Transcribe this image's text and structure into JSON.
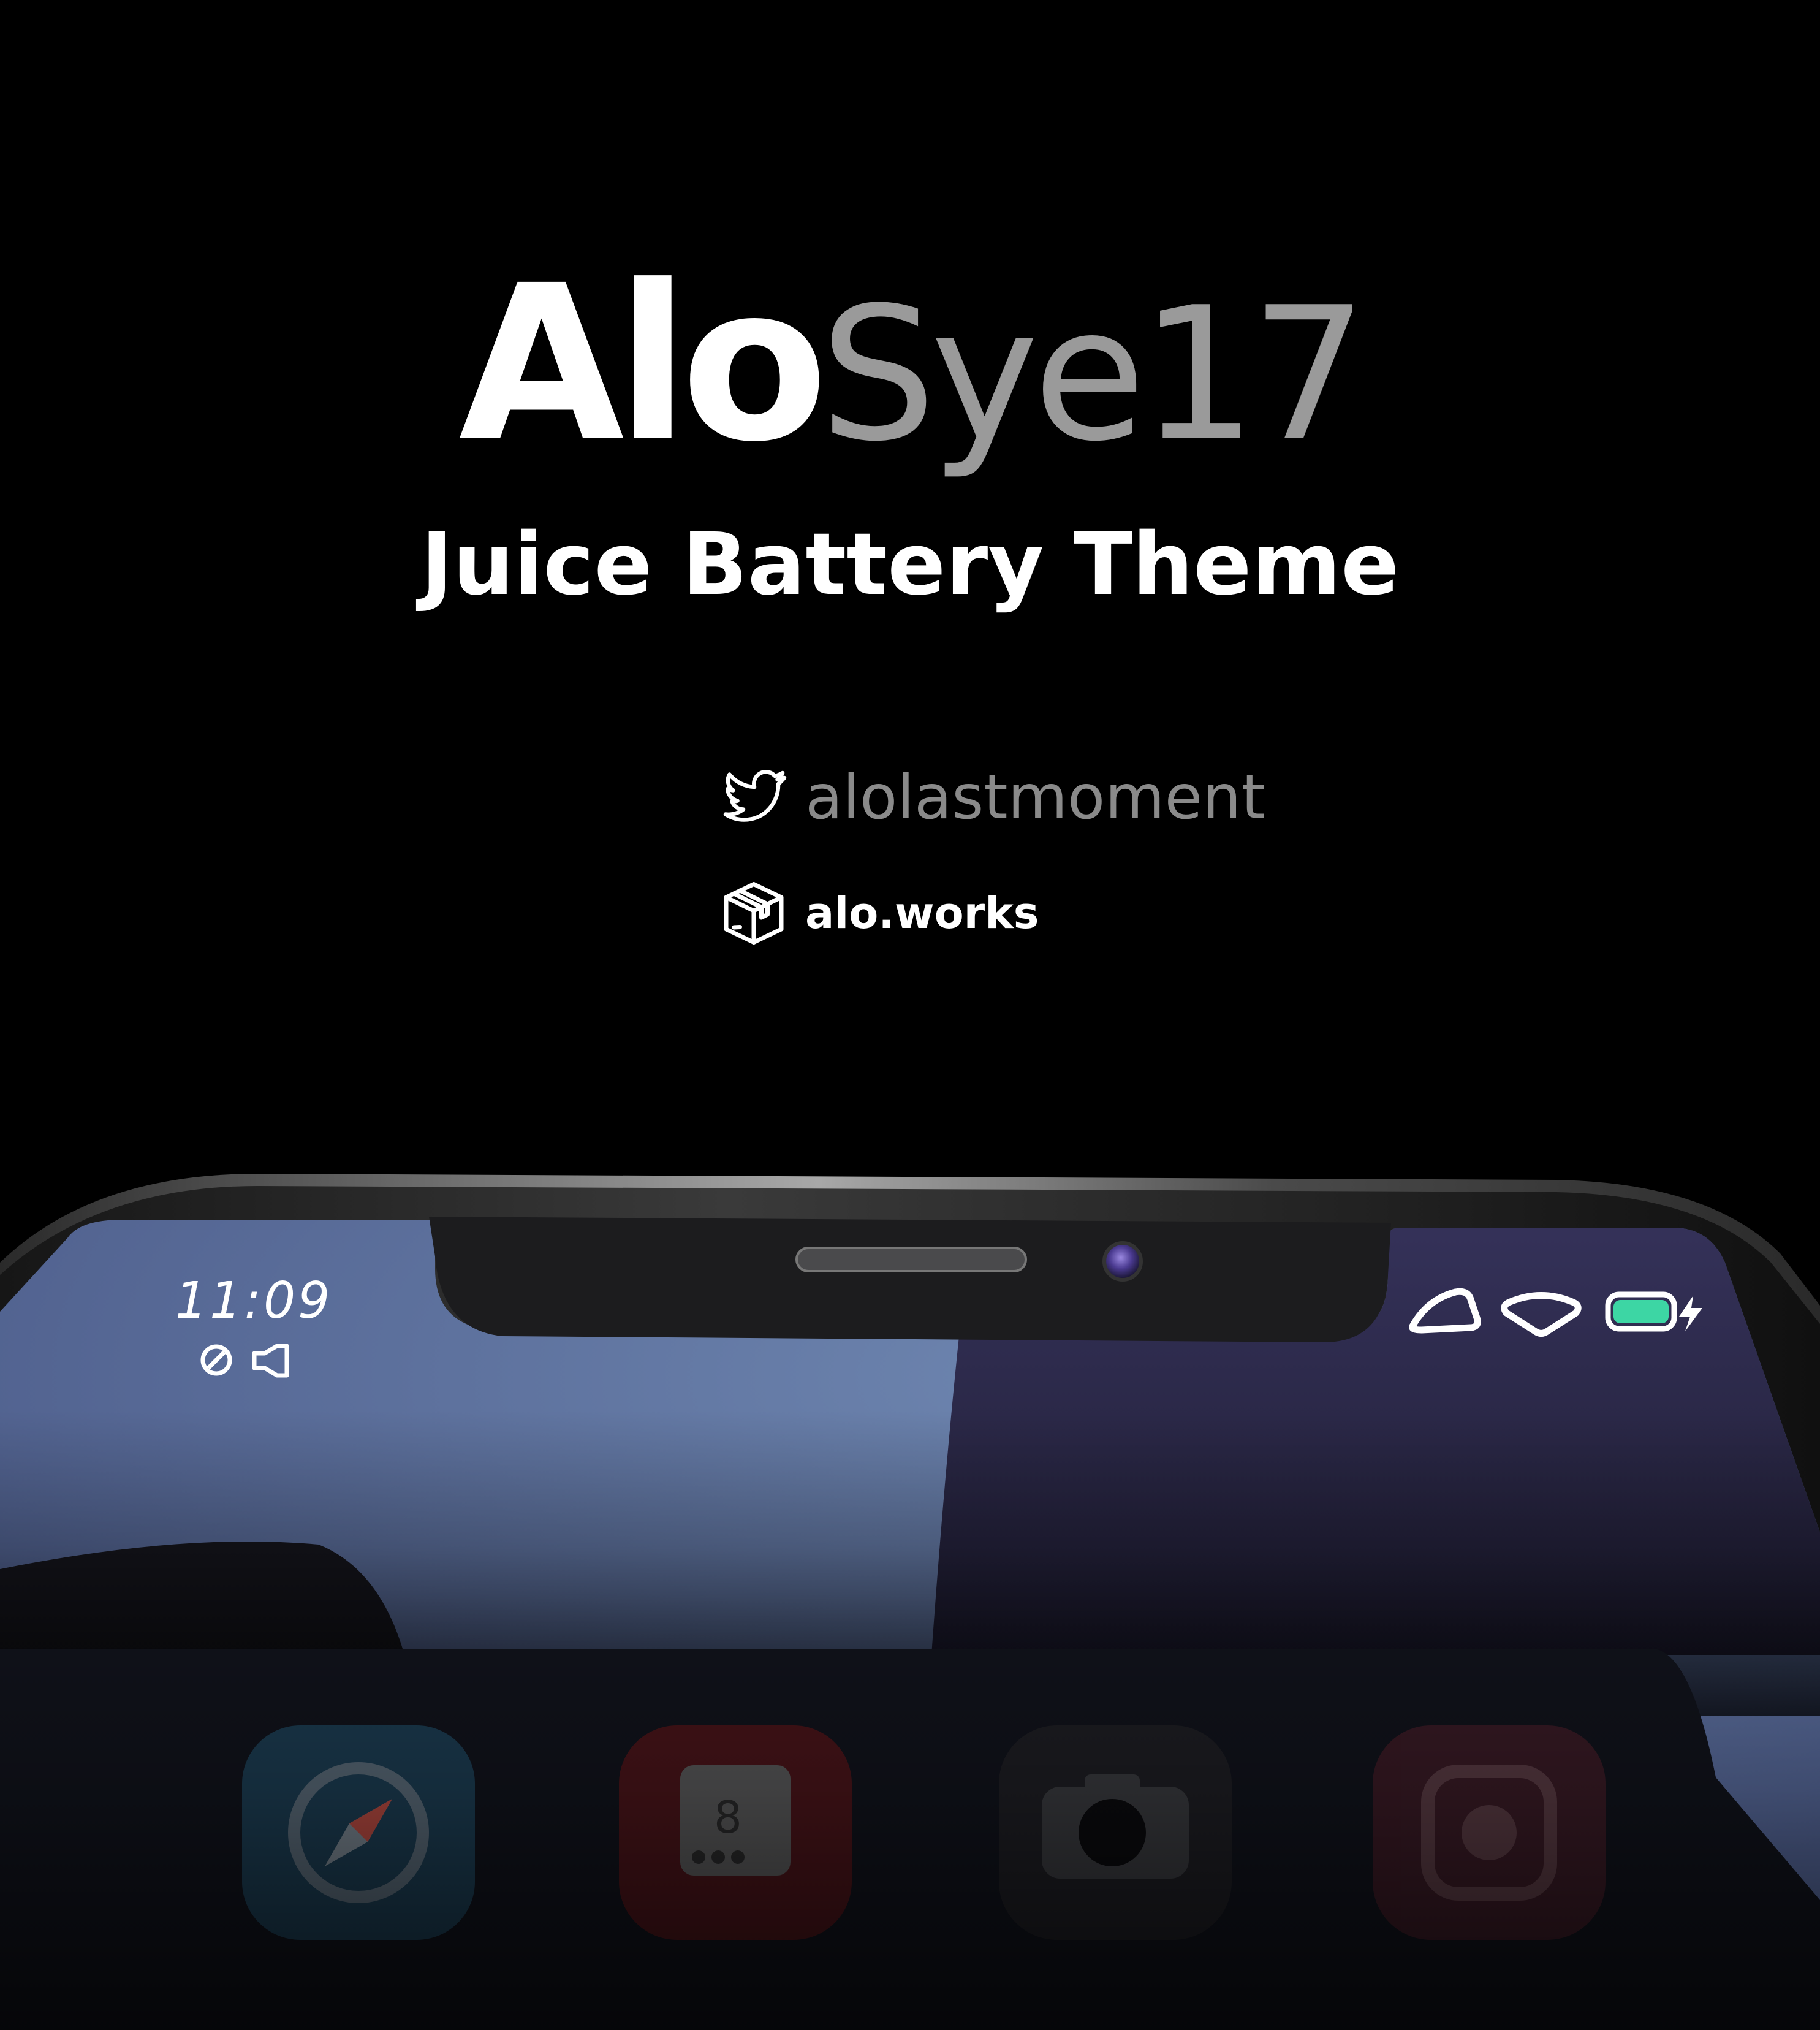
{
  "title": {
    "bold": "Alo",
    "light": "Sye17"
  },
  "subtitle": "Juice Battery Theme",
  "links": {
    "twitter": {
      "icon": "twitter-icon",
      "handle": "alolastmoment"
    },
    "website": {
      "icon": "box-package-icon",
      "label": "alo.works"
    }
  },
  "phone": {
    "status_bar": {
      "time": "11:09",
      "left_icons": [
        "data-saver-icon",
        "speaker-icon"
      ],
      "right_icons": [
        "cellular-signal-icon",
        "wifi-icon",
        "battery-charging-icon"
      ],
      "battery_color": "#3dd6a4"
    },
    "dock_icons": [
      "safari-compass-icon",
      "calendar-icon",
      "camera-icon",
      "instagram-icon"
    ],
    "calendar_day": "8"
  },
  "colors": {
    "background": "#000000",
    "title_light": "#9a9a9a",
    "handle": "#8a8a8a",
    "wallpaper_blue": "#5a6c9a",
    "wallpaper_purple": "#2c2a4a"
  }
}
